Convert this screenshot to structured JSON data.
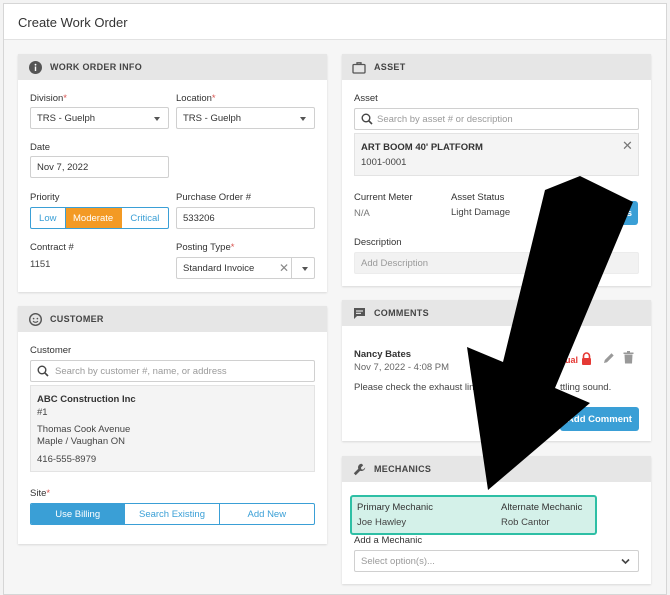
{
  "page": {
    "title": "Create Work Order"
  },
  "work_order_info": {
    "header": "WORK ORDER INFO",
    "division_label": "Division",
    "division_value": "TRS - Guelph",
    "location_label": "Location",
    "location_value": "TRS - Guelph",
    "date_label": "Date",
    "date_value": "Nov 7, 2022",
    "priority_label": "Priority",
    "priority_options": [
      "Low",
      "Moderate",
      "Critical"
    ],
    "priority_selected": "Moderate",
    "po_label": "Purchase Order #",
    "po_value": "533206",
    "contract_label": "Contract #",
    "contract_value": "1151",
    "posting_label": "Posting Type",
    "posting_value": "Standard Invoice"
  },
  "asset": {
    "header": "ASSET",
    "asset_label": "Asset",
    "search_placeholder": "Search by asset # or description",
    "asset_name": "ART BOOM 40' PLATFORM",
    "asset_number": "1001-0001",
    "meter_label": "Current Meter",
    "meter_value": "N/A",
    "status_label": "Asset Status",
    "status_value": "Light Damage",
    "details_button_partial": "ails",
    "description_label": "Description",
    "description_placeholder": "Add Description"
  },
  "customer": {
    "header": "CUSTOMER",
    "customer_label": "Customer",
    "search_placeholder": "Search by customer #, name, or address",
    "name": "ABC Construction Inc",
    "number": "#1",
    "address_line1": "Thomas Cook Avenue",
    "address_line2": "Maple / Vaughan ON",
    "phone": "416-555-8979",
    "site_label": "Site",
    "site_options": [
      "Use Billing",
      "Search Existing",
      "Add New"
    ],
    "site_selected": "Use Billing"
  },
  "comments": {
    "header": "COMMENTS",
    "author": "Nancy Bates",
    "timestamp": "Nov 7, 2022 - 4:08 PM",
    "internal_partial": "ual",
    "text_left": "Please check the exhaust line",
    "text_right": "ttling sound.",
    "add_button": "Add Comment"
  },
  "mechanics": {
    "header": "MECHANICS",
    "primary_label": "Primary Mechanic",
    "primary_value": "Joe Hawley",
    "alternate_label": "Alternate Mechanic",
    "alternate_value": "Rob Cantor",
    "add_label": "Add a Mechanic",
    "select_placeholder": "Select option(s)..."
  },
  "colors": {
    "accent_blue": "#3a9fd6",
    "priority_orange": "#f39a24",
    "highlight_teal": "#2ebfa5",
    "highlight_fill": "#d4f1e9",
    "lock_red": "#e53935"
  },
  "icons": [
    "info-icon",
    "briefcase-icon",
    "smiley-icon",
    "chat-icon",
    "wrench-icon",
    "search-icon",
    "close-icon",
    "chevron-down-icon",
    "lock-icon",
    "pencil-icon",
    "trash-icon",
    "arrow-annotation"
  ]
}
